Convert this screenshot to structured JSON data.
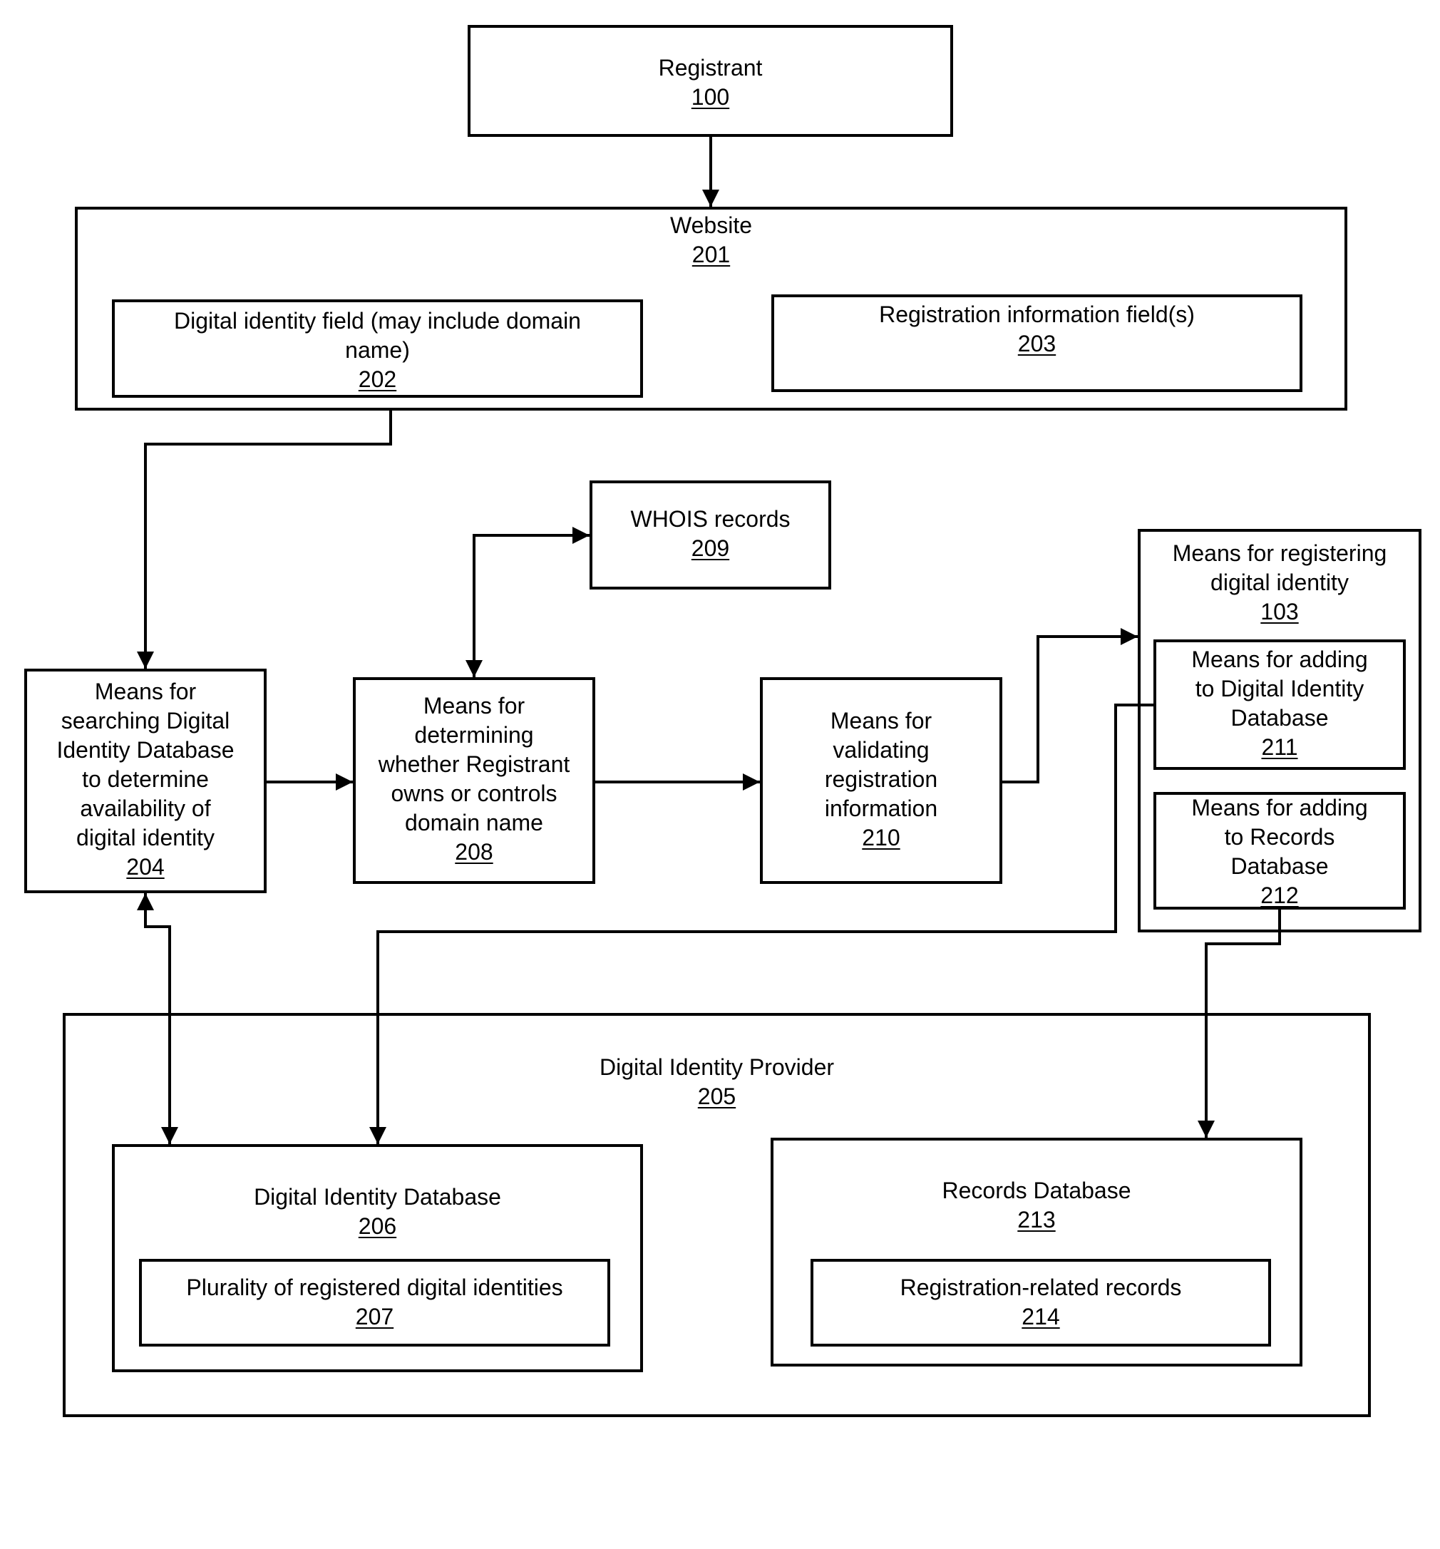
{
  "diagram": {
    "nodes": {
      "registrant": {
        "label": "Registrant",
        "ref": "100"
      },
      "website": {
        "label": "Website",
        "ref": "201"
      },
      "digital_identity_field": {
        "label": "Digital identity field (may include domain\nname)",
        "ref": "202"
      },
      "registration_info_fields": {
        "label": "Registration information field(s)",
        "ref": "203"
      },
      "whois_records": {
        "label": "WHOIS records",
        "ref": "209"
      },
      "search_means": {
        "label": "Means for\nsearching Digital\nIdentity Database\nto determine\navailability of\ndigital identity",
        "ref": "204"
      },
      "ownership_means": {
        "label": "Means for\ndetermining\nwhether Registrant\nowns or controls\ndomain name",
        "ref": "208"
      },
      "validation_means": {
        "label": "Means for\nvalidating\nregistration\ninformation",
        "ref": "210"
      },
      "registering_means": {
        "label": "Means for registering\ndigital identity",
        "ref": "103"
      },
      "add_identity_db_means": {
        "label": "Means for adding\nto Digital Identity\nDatabase",
        "ref": "211"
      },
      "add_records_db_means": {
        "label": "Means for adding\nto Records\nDatabase",
        "ref": "212"
      },
      "provider": {
        "label": "Digital Identity Provider",
        "ref": "205"
      },
      "identity_db": {
        "label": "Digital Identity Database",
        "ref": "206"
      },
      "registered_identities": {
        "label": "Plurality of  registered digital identities",
        "ref": "207"
      },
      "records_db": {
        "label": "Records Database",
        "ref": "213"
      },
      "registration_records": {
        "label": "Registration-related records",
        "ref": "214"
      }
    },
    "edges": [
      {
        "from": "100",
        "to": "201",
        "direction": "forward"
      },
      {
        "from": "202",
        "to": "204",
        "direction": "forward"
      },
      {
        "from": "204",
        "to": "208",
        "direction": "forward"
      },
      {
        "from": "208",
        "to": "209",
        "direction": "bidirectional"
      },
      {
        "from": "208",
        "to": "210",
        "direction": "forward"
      },
      {
        "from": "210",
        "to": "103",
        "direction": "forward"
      },
      {
        "from": "204",
        "to": "206",
        "direction": "bidirectional"
      },
      {
        "from": "211",
        "to": "206",
        "direction": "forward"
      },
      {
        "from": "212",
        "to": "213",
        "direction": "forward"
      }
    ]
  }
}
